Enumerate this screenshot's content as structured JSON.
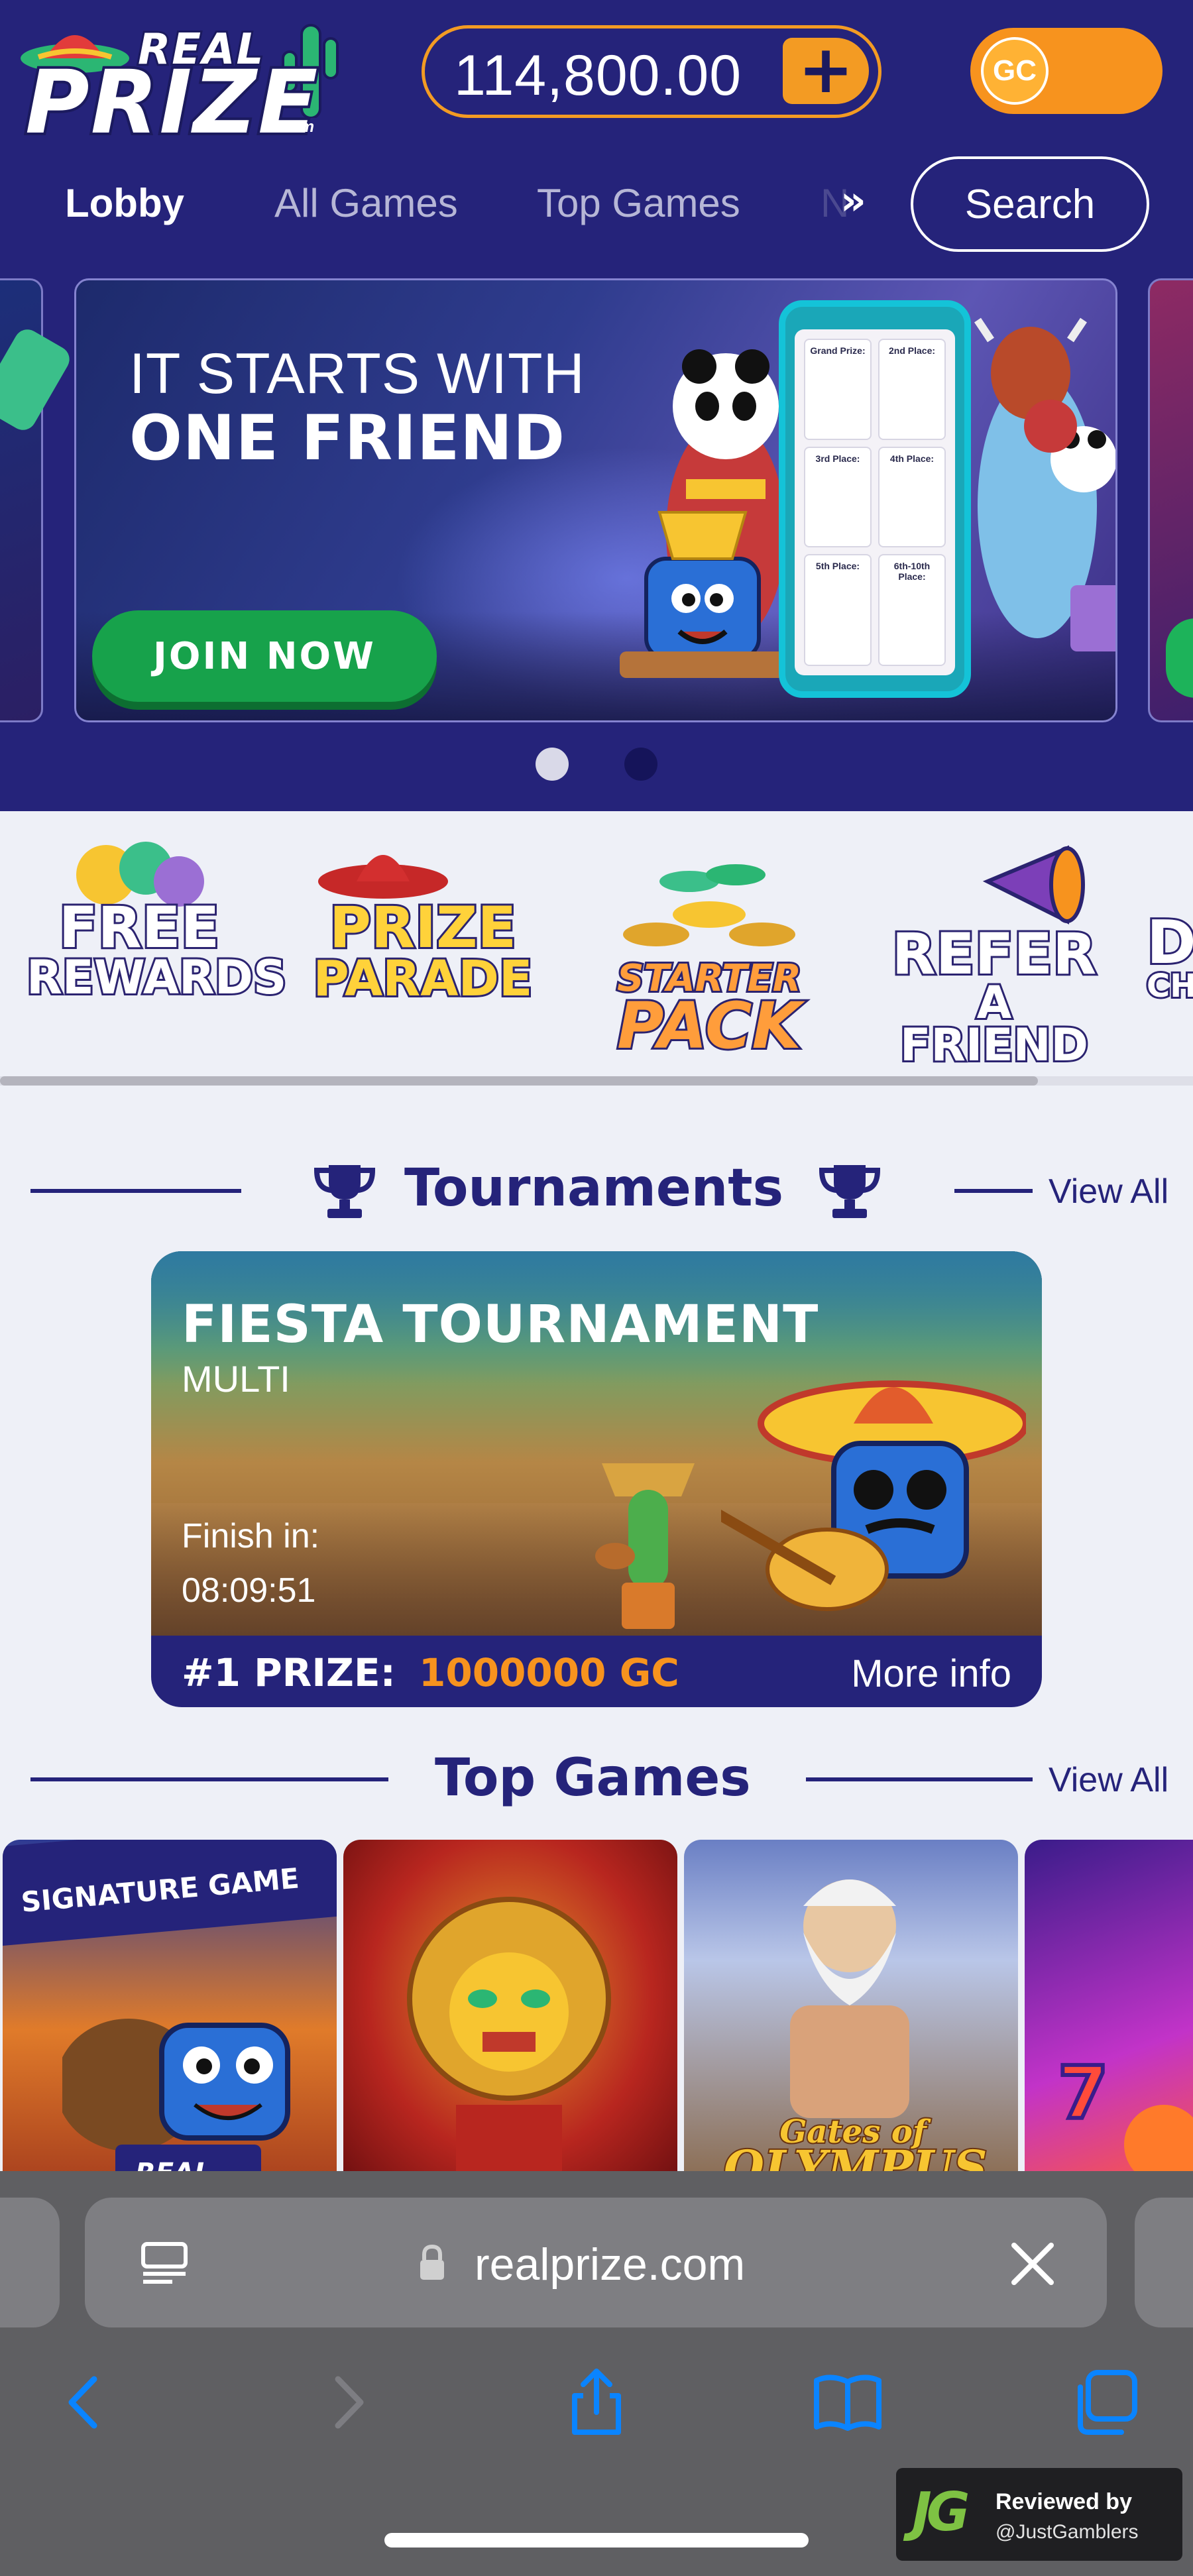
{
  "brand": {
    "logo_top": "REAL",
    "logo_main": "PRIZE",
    "logo_suffix": ".com"
  },
  "header": {
    "balance": "114,800.00",
    "add_coins_symbol": "+",
    "currency_toggle": "GC"
  },
  "nav": {
    "tabs": [
      {
        "label": "Lobby",
        "active": true
      },
      {
        "label": "All Games",
        "active": false
      },
      {
        "label": "Top Games",
        "active": false
      }
    ],
    "partial_tab": "N",
    "more_icon": "double-chevron-right-icon",
    "search_label": "Search"
  },
  "banner": {
    "line1": "IT STARTS WITH",
    "line2": "ONE FRIEND",
    "cta": "JOIN NOW",
    "phone_cells": [
      "Grand Prize:",
      "2nd Place:",
      "3rd Place:",
      "4th Place:",
      "5th Place:",
      "6th-10th Place:"
    ],
    "active_slide": 1,
    "slide_count": 2
  },
  "promos": [
    {
      "lines": [
        "FREE",
        "REWARDS"
      ]
    },
    {
      "lines": [
        "PRIZE",
        "PARADE"
      ]
    },
    {
      "lines": [
        "STARTER",
        "PACK"
      ]
    },
    {
      "lines": [
        "REFER",
        "A FRIEND"
      ]
    },
    {
      "lines": [
        "D",
        "CH"
      ]
    }
  ],
  "tournaments": {
    "title": "Tournaments",
    "view_all": "View All",
    "card": {
      "name": "FIESTA TOURNAMENT",
      "type": "MULTI",
      "finish_label": "Finish in:",
      "time_left": "08:09:51",
      "prize_label": "#1 PRIZE:",
      "prize_value": "1000000 GC",
      "more_info": "More info"
    }
  },
  "top_games": {
    "title": "Top Games",
    "view_all": "View All",
    "games": [
      {
        "badge": "SIGNATURE GAME",
        "footer": "REAL"
      },
      {
        "badge": ""
      },
      {
        "badge": "",
        "logo_lines": [
          "Gates of",
          "OLYMPUS"
        ]
      },
      {
        "badge": ""
      }
    ]
  },
  "browser": {
    "url": "realprize.com"
  },
  "watermark": {
    "logo": "JG",
    "line1": "Reviewed by",
    "line2": "@JustGamblers"
  },
  "colors": {
    "header_bg": "#25237a",
    "accent_orange": "#f7931e",
    "join_green": "#17a24b",
    "page_bg": "#eef0f7",
    "browser_chrome": "#5f5f62",
    "ios_blue": "#0a84ff"
  }
}
